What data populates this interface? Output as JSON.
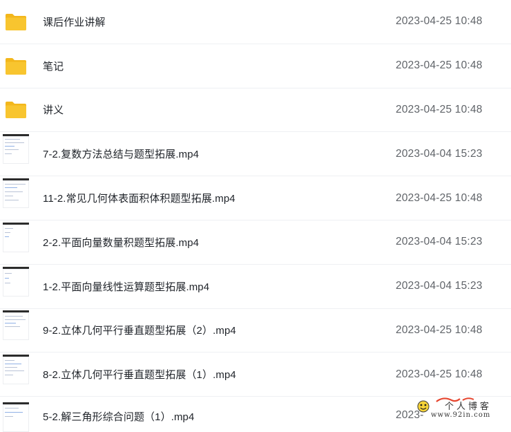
{
  "files": [
    {
      "type": "folder",
      "name": "课后作业讲解",
      "date": "2023-04-25 10:48"
    },
    {
      "type": "folder",
      "name": "笔记",
      "date": "2023-04-25 10:48"
    },
    {
      "type": "folder",
      "name": "讲义",
      "date": "2023-04-25 10:48"
    },
    {
      "type": "video",
      "name": "7-2.复数方法总结与题型拓展.mp4",
      "date": "2023-04-04 15:23"
    },
    {
      "type": "video",
      "name": "11-2.常见几何体表面积体积题型拓展.mp4",
      "date": "2023-04-25 10:48"
    },
    {
      "type": "video",
      "name": "2-2.平面向量数量积题型拓展.mp4",
      "date": "2023-04-04 15:23"
    },
    {
      "type": "video",
      "name": "1-2.平面向量线性运算题型拓展.mp4",
      "date": "2023-04-04 15:23"
    },
    {
      "type": "video",
      "name": "9-2.立体几何平行垂直题型拓展（2）.mp4",
      "date": "2023-04-25 10:48"
    },
    {
      "type": "video",
      "name": "8-2.立体几何平行垂直题型拓展（1）.mp4",
      "date": "2023-04-25 10:48"
    },
    {
      "type": "video",
      "name": "5-2.解三角形综合问题（1）.mp4",
      "date": "2023-"
    }
  ],
  "watermark": {
    "line1": "个人博客",
    "line2": "www.92in.com"
  },
  "colors": {
    "folder": "#f8c52f",
    "folder_tab": "#f3b71c",
    "date": "#5f6368",
    "divider": "#eef0f3"
  }
}
